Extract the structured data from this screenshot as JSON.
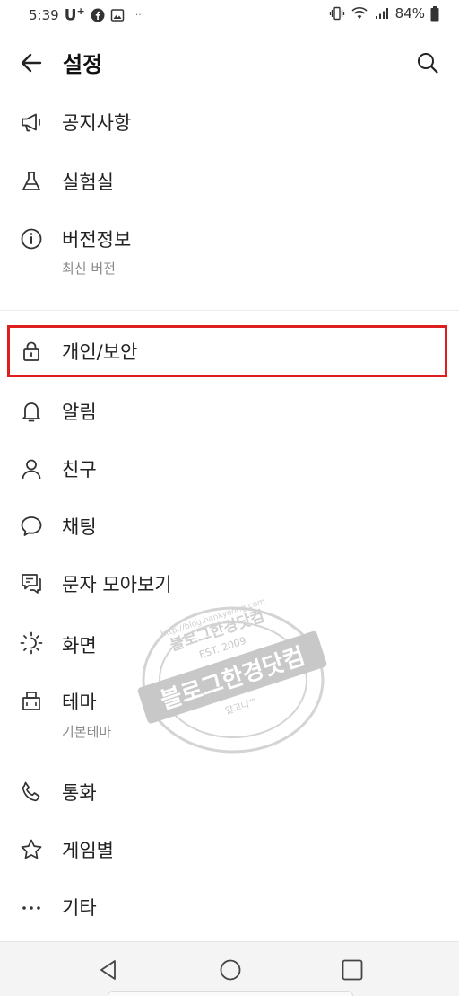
{
  "status_bar": {
    "time": "5:39",
    "carrier": "U",
    "carrier_sup": "+",
    "more": "···",
    "battery": "84%"
  },
  "header": {
    "title": "설정"
  },
  "menu": [
    {
      "label": "공지사항",
      "icon": "megaphone-icon"
    },
    {
      "label": "실험실",
      "icon": "flask-icon"
    },
    {
      "label": "버전정보",
      "sub": "최신 버전",
      "icon": "info-icon"
    },
    {
      "label": "개인/보안",
      "icon": "lock-icon"
    },
    {
      "label": "알림",
      "icon": "bell-icon"
    },
    {
      "label": "친구",
      "icon": "person-icon"
    },
    {
      "label": "채팅",
      "icon": "chat-bubble-icon"
    },
    {
      "label": "문자 모아보기",
      "icon": "sms-icon"
    },
    {
      "label": "화면",
      "icon": "brightness-icon"
    },
    {
      "label": "테마",
      "sub": "기본테마",
      "icon": "theme-brush-icon"
    },
    {
      "label": "통화",
      "icon": "phone-icon"
    },
    {
      "label": "게임별",
      "icon": "star-icon"
    },
    {
      "label": "기타",
      "icon": "more-dots-icon"
    }
  ],
  "watermark": {
    "main": "블로그한경닷컴",
    "est": "EST. 2009",
    "url": "http://blog.hankyeong.com",
    "top": "블로그한경닷컴",
    "sub": "알고나™"
  },
  "highlight_color": "#dd1f1f"
}
